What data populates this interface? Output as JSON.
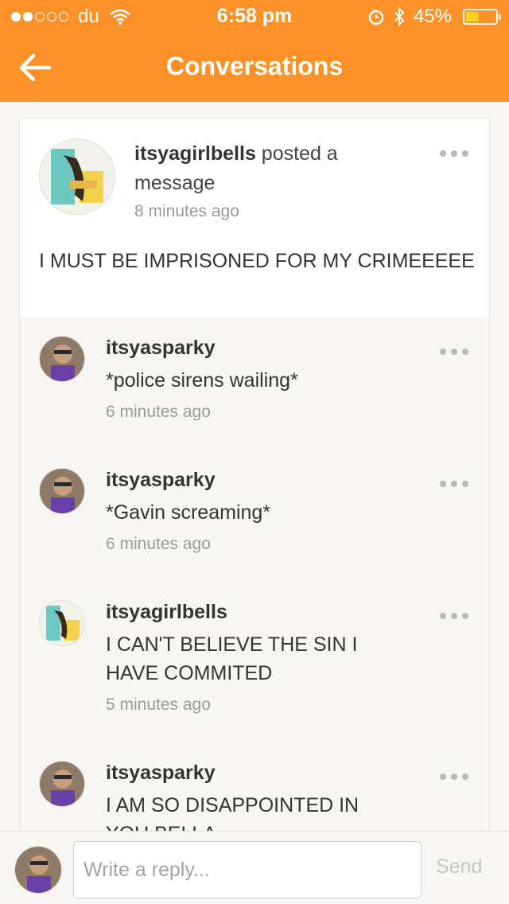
{
  "status_bar": {
    "carrier": "du",
    "time": "6:58 pm",
    "battery_percent": "45%",
    "battery_level": 0.45,
    "signal_bars_filled": 2,
    "signal_bars_total": 5
  },
  "header": {
    "title": "Conversations",
    "back_icon": "arrow-left-icon",
    "accent_color": "#fb9128"
  },
  "post": {
    "username": "itsyagirlbells",
    "action": " posted a message",
    "time": "8 minutes ago",
    "body": "I MUST BE IMPRISONED FOR MY CRIMEEEEE"
  },
  "replies": [
    {
      "username": "itsyasparky",
      "message": "*police sirens wailing*",
      "time": "6 minutes ago"
    },
    {
      "username": "itsyasparky",
      "message": "*Gavin screaming*",
      "time": "6 minutes ago"
    },
    {
      "username": "itsyagirlbells",
      "message": "I CAN'T BELIEVE THE SIN I HAVE COMMITED",
      "time": "5 minutes ago"
    },
    {
      "username": "itsyasparky",
      "message": "I AM SO DISAPPOINTED IN YOU BELLA",
      "time": ""
    }
  ],
  "composer": {
    "placeholder": "Write a reply...",
    "send_label": "Send"
  }
}
